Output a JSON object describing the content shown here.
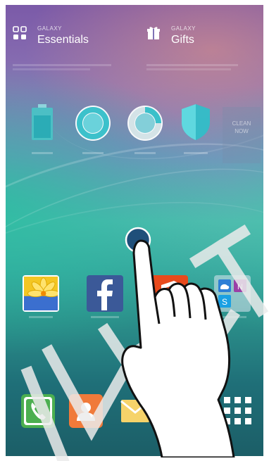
{
  "widgets": {
    "essentials": {
      "kicker": "GALAXY",
      "title": "Essentials",
      "icon": "galaxy-apps-icon"
    },
    "gifts": {
      "kicker": "GALAXY",
      "title": "Gifts",
      "icon": "gift-icon"
    }
  },
  "optimizer": {
    "battery": {
      "icon": "battery-icon"
    },
    "storage": {
      "icon": "storage-ring-icon"
    },
    "ram": {
      "icon": "ram-ring-icon"
    },
    "device_security": {
      "icon": "shield-icon"
    },
    "clean_now": {
      "line1": "CLEAN",
      "line2": "NOW"
    }
  },
  "apps": [
    {
      "icon": "gallery-icon"
    },
    {
      "icon": "facebook-icon"
    },
    {
      "icon": "office-icon"
    },
    {
      "icon": "microsoft-apps-folder-icon"
    }
  ],
  "dock": [
    {
      "icon": "phone-icon"
    },
    {
      "icon": "contacts-icon"
    },
    {
      "icon": "email-icon"
    },
    {
      "icon": "apps-grid-icon"
    }
  ],
  "gesture": {
    "icon": "tap-gesture-hand-icon"
  },
  "watermark": {
    "icon": "draft-watermark"
  },
  "colors": {
    "facebook": "#3b5998",
    "phone": "#4caf50",
    "contacts": "#f07a3a",
    "office": "#e84a1c",
    "touch_point": "#1f4f7a"
  }
}
